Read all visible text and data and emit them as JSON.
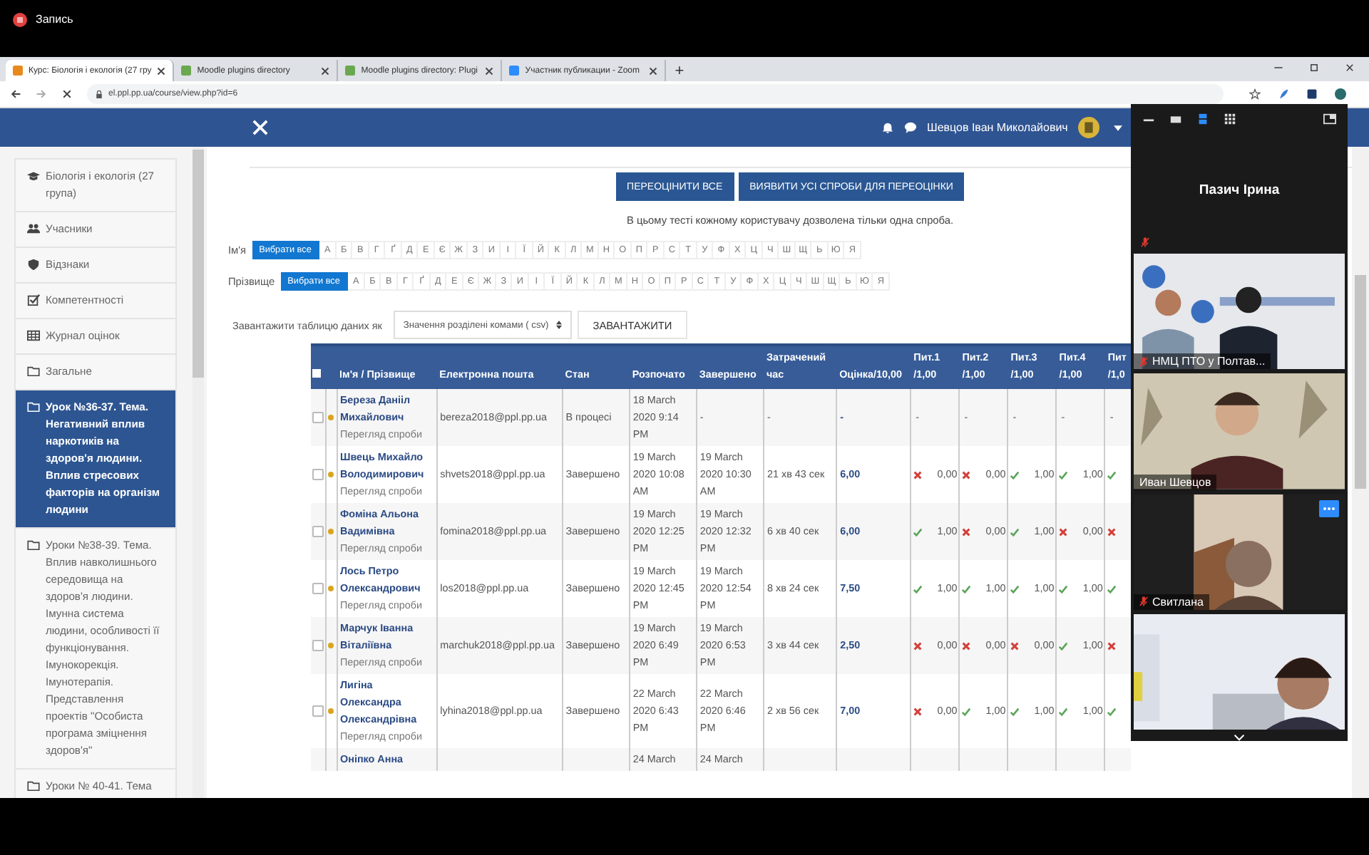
{
  "recording": {
    "label": "Запись"
  },
  "browser": {
    "tabs": [
      {
        "title": "Курс: Біологія і екологія (27 гру",
        "selected": true
      },
      {
        "title": "Moodle plugins directory",
        "selected": false
      },
      {
        "title": "Moodle plugins directory: Plugi",
        "selected": false
      },
      {
        "title": "Участник публикации - Zoom",
        "selected": false
      }
    ],
    "new_tab": "+",
    "url": "el.ppl.pp.ua/course/view.php?id=6"
  },
  "navbar": {
    "user": "Шевцов Іван Миколайович"
  },
  "sidebar": {
    "items": [
      {
        "text": "Біологія і екологія (27 група)",
        "selected": false
      },
      {
        "text": "Учасники",
        "selected": false
      },
      {
        "text": "Відзнаки",
        "selected": false
      },
      {
        "text": "Компетентності",
        "selected": false
      },
      {
        "text": "Журнал оцінок",
        "selected": false
      },
      {
        "text": "Загальне",
        "selected": false
      },
      {
        "text": "Урок №36-37. Тема. Негативний вплив наркотиків на здоров'я людини. Вплив стресових факторів на організм людини",
        "selected": true
      },
      {
        "text": "Уроки №38-39. Тема. Вплив навколишнього середовища на здоров'я людини. Імунна система людини, особливості її функціонування. Імунокорекція. Імунотерапія. Представлення проектів \"Особиста програма зміцнення здоров'я\"",
        "selected": false
      },
      {
        "text": "Уроки № 40-41. Тема",
        "selected": false
      }
    ]
  },
  "actions": [
    "ПЕРЕОЦІНИТИ ВСЕ",
    "ВИЯВИТИ УСІ СПРОБИ ДЛЯ ПЕРЕОЦІНКИ"
  ],
  "notice": "В цьому тесті кожному користувачу дозволена тільки одна спроба.",
  "initials_bars": [
    {
      "label": "Ім'я",
      "items": [
        {
          "text": "Вибрати все",
          "selected": true
        },
        {
          "text": "А",
          "selected": false
        },
        {
          "text": "Б",
          "selected": false
        },
        {
          "text": "В",
          "selected": false
        },
        {
          "text": "Г",
          "selected": false
        },
        {
          "text": "Ґ",
          "selected": false
        },
        {
          "text": "Д",
          "selected": false
        },
        {
          "text": "Е",
          "selected": false
        },
        {
          "text": "Є",
          "selected": false
        },
        {
          "text": "Ж",
          "selected": false
        },
        {
          "text": "З",
          "selected": false
        },
        {
          "text": "И",
          "selected": false
        },
        {
          "text": "І",
          "selected": false
        },
        {
          "text": "Ї",
          "selected": false
        },
        {
          "text": "Й",
          "selected": false
        },
        {
          "text": "К",
          "selected": false
        },
        {
          "text": "Л",
          "selected": false
        },
        {
          "text": "М",
          "selected": false
        },
        {
          "text": "Н",
          "selected": false
        },
        {
          "text": "О",
          "selected": false
        },
        {
          "text": "П",
          "selected": false
        },
        {
          "text": "Р",
          "selected": false
        },
        {
          "text": "С",
          "selected": false
        },
        {
          "text": "Т",
          "selected": false
        },
        {
          "text": "У",
          "selected": false
        },
        {
          "text": "Ф",
          "selected": false
        },
        {
          "text": "Х",
          "selected": false
        },
        {
          "text": "Ц",
          "selected": false
        },
        {
          "text": "Ч",
          "selected": false
        },
        {
          "text": "Ш",
          "selected": false
        },
        {
          "text": "Щ",
          "selected": false
        },
        {
          "text": "Ь",
          "selected": false
        },
        {
          "text": "Ю",
          "selected": false
        },
        {
          "text": "Я",
          "selected": false
        }
      ]
    },
    {
      "label": "Прізвище",
      "items": [
        {
          "text": "Вибрати все",
          "selected": true
        },
        {
          "text": "А",
          "selected": false
        },
        {
          "text": "Б",
          "selected": false
        },
        {
          "text": "В",
          "selected": false
        },
        {
          "text": "Г",
          "selected": false
        },
        {
          "text": "Ґ",
          "selected": false
        },
        {
          "text": "Д",
          "selected": false
        },
        {
          "text": "Е",
          "selected": false
        },
        {
          "text": "Є",
          "selected": false
        },
        {
          "text": "Ж",
          "selected": false
        },
        {
          "text": "З",
          "selected": false
        },
        {
          "text": "И",
          "selected": false
        },
        {
          "text": "І",
          "selected": false
        },
        {
          "text": "Ї",
          "selected": false
        },
        {
          "text": "Й",
          "selected": false
        },
        {
          "text": "К",
          "selected": false
        },
        {
          "text": "Л",
          "selected": false
        },
        {
          "text": "М",
          "selected": false
        },
        {
          "text": "Н",
          "selected": false
        },
        {
          "text": "О",
          "selected": false
        },
        {
          "text": "П",
          "selected": false
        },
        {
          "text": "Р",
          "selected": false
        },
        {
          "text": "С",
          "selected": false
        },
        {
          "text": "Т",
          "selected": false
        },
        {
          "text": "У",
          "selected": false
        },
        {
          "text": "Ф",
          "selected": false
        },
        {
          "text": "Х",
          "selected": false
        },
        {
          "text": "Ц",
          "selected": false
        },
        {
          "text": "Ч",
          "selected": false
        },
        {
          "text": "Ш",
          "selected": false
        },
        {
          "text": "Щ",
          "selected": false
        },
        {
          "text": "Ь",
          "selected": false
        },
        {
          "text": "Ю",
          "selected": false
        },
        {
          "text": "Я",
          "selected": false
        }
      ]
    }
  ],
  "download": {
    "label": "Завантажити таблицю даних як",
    "select": "Значення розділені комами ( csv)",
    "button": "ЗАВАНТАЖИТИ"
  },
  "table": {
    "columns": [
      {
        "kind": "select",
        "checked": false
      },
      {
        "kind": "flag"
      },
      {
        "kind": "text",
        "label": "Ім'я / Прізвище"
      },
      {
        "kind": "text",
        "label": "Електронна пошта"
      },
      {
        "kind": "text",
        "label": "Стан"
      },
      {
        "kind": "text",
        "label": "Розпочато"
      },
      {
        "kind": "text",
        "label": "Завершено"
      },
      {
        "kind": "text",
        "label": "Затрачений час"
      },
      {
        "kind": "text",
        "label": "Оцінка/10,00"
      },
      {
        "kind": "text",
        "label": "Пит.1 /1,00"
      },
      {
        "kind": "text",
        "label": "Пит.2 /1,00"
      },
      {
        "kind": "text",
        "label": "Пит.3 /1,00"
      },
      {
        "kind": "text",
        "label": "Пит.4 /1,00"
      },
      {
        "kind": "text",
        "label": "Пит /1,0"
      }
    ],
    "rows": [
      {
        "checked": false,
        "name": "Береза Данііл Михайлович",
        "link": "Перегляд спроби",
        "email": "bereza2018@ppl.pp.ua",
        "state": "В процесі",
        "started": "18 March 2020 9:14 PM",
        "finished": "-",
        "time": "-",
        "grade": "-",
        "questions": [
          {
            "kind": "none",
            "text": "-"
          },
          {
            "kind": "none",
            "text": "-"
          },
          {
            "kind": "none",
            "text": "-"
          },
          {
            "kind": "none",
            "text": "-"
          },
          {
            "kind": "none",
            "text": "-"
          }
        ]
      },
      {
        "checked": false,
        "name": "Швець Михайло Володимирович",
        "link": "Перегляд спроби",
        "email": "shvets2018@ppl.pp.ua",
        "state": "Завершено",
        "started": "19 March 2020 10:08 AM",
        "finished": "19 March 2020 10:30 AM",
        "time": "21 хв 43 сек",
        "grade": "6,00",
        "questions": [
          {
            "kind": "wrong",
            "text": "0,00"
          },
          {
            "kind": "wrong",
            "text": "0,00"
          },
          {
            "kind": "correct",
            "text": "1,00"
          },
          {
            "kind": "correct",
            "text": "1,00"
          },
          {
            "kind": "correct"
          }
        ]
      },
      {
        "checked": false,
        "name": "Фоміна Альона Вадимівна",
        "link": "Перегляд спроби",
        "email": "fomina2018@ppl.pp.ua",
        "state": "Завершено",
        "started": "19 March 2020 12:25 PM",
        "finished": "19 March 2020 12:32 PM",
        "time": "6 хв 40 сек",
        "grade": "6,00",
        "questions": [
          {
            "kind": "correct",
            "text": "1,00"
          },
          {
            "kind": "wrong",
            "text": "0,00"
          },
          {
            "kind": "correct",
            "text": "1,00"
          },
          {
            "kind": "wrong",
            "text": "0,00"
          },
          {
            "kind": "wrong"
          }
        ]
      },
      {
        "checked": false,
        "name": "Лось Петро Олександрович",
        "link": "Перегляд спроби",
        "email": "los2018@ppl.pp.ua",
        "state": "Завершено",
        "started": "19 March 2020 12:45 PM",
        "finished": "19 March 2020 12:54 PM",
        "time": "8 хв 24 сек",
        "grade": "7,50",
        "questions": [
          {
            "kind": "correct",
            "text": "1,00"
          },
          {
            "kind": "correct",
            "text": "1,00"
          },
          {
            "kind": "correct",
            "text": "1,00"
          },
          {
            "kind": "correct",
            "text": "1,00"
          },
          {
            "kind": "correct"
          }
        ]
      },
      {
        "checked": false,
        "name": "Марчук Іванна Віталіївна",
        "link": "Перегляд спроби",
        "email": "marchuk2018@ppl.pp.ua",
        "state": "Завершено",
        "started": "19 March 2020 6:49 PM",
        "finished": "19 March 2020 6:53 PM",
        "time": "3 хв 44 сек",
        "grade": "2,50",
        "questions": [
          {
            "kind": "wrong",
            "text": "0,00"
          },
          {
            "kind": "wrong",
            "text": "0,00"
          },
          {
            "kind": "wrong",
            "text": "0,00"
          },
          {
            "kind": "correct",
            "text": "1,00"
          },
          {
            "kind": "wrong"
          }
        ]
      },
      {
        "checked": false,
        "name": "Лигіна Олександра Олександрівна",
        "link": "Перегляд спроби",
        "email": "lyhina2018@ppl.pp.ua",
        "state": "Завершено",
        "started": "22 March 2020 6:43 PM",
        "finished": "22 March 2020 6:46 PM",
        "time": "2 хв 56 сек",
        "grade": "7,00",
        "questions": [
          {
            "kind": "wrong",
            "text": "0,00"
          },
          {
            "kind": "correct",
            "text": "1,00"
          },
          {
            "kind": "correct",
            "text": "1,00"
          },
          {
            "kind": "correct",
            "text": "1,00"
          },
          {
            "kind": "correct"
          }
        ]
      },
      {
        "name": "Оніпко Анна",
        "started": "24 March",
        "finished": "24 March"
      }
    ]
  },
  "zoom": {
    "views": [
      {
        "kind": "single",
        "selected": false
      },
      {
        "kind": "speaker",
        "selected": true
      },
      {
        "kind": "gallery",
        "selected": false
      }
    ],
    "speaker": {
      "name": "Пазич Ірина",
      "muted": true
    },
    "tiles": [
      {
        "kind": "picture",
        "name": "НМЦ ПТО у Полтав...",
        "muted": true,
        "menu": false
      },
      {
        "kind": "picture",
        "name": "Иван Шевцов",
        "muted": false,
        "menu": false
      },
      {
        "kind": "picture",
        "name": "Свитлана",
        "muted": true,
        "menu": true
      },
      {
        "kind": "picture",
        "muted": false,
        "menu": false
      }
    ]
  }
}
